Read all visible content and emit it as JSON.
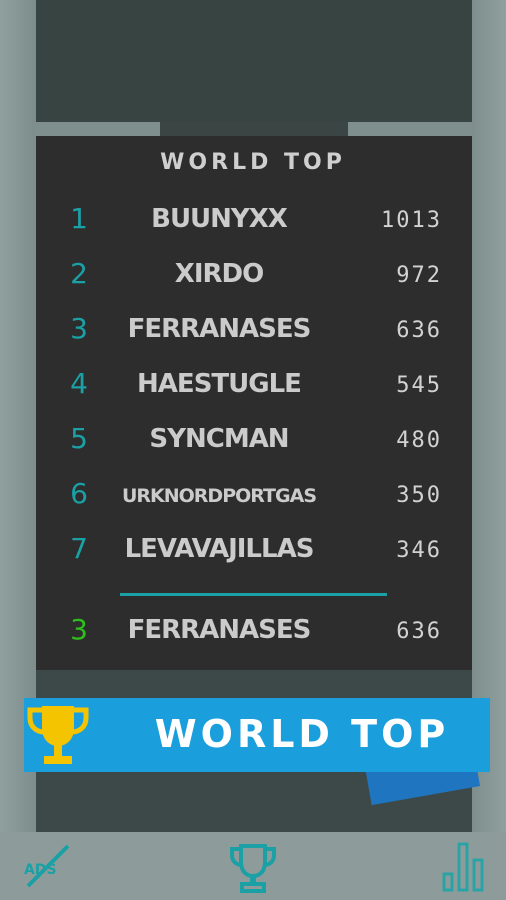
{
  "leaderboard": {
    "title": "WORLD TOP",
    "rows": [
      {
        "rank": "1",
        "name": "BUUNYXX",
        "score": "1013"
      },
      {
        "rank": "2",
        "name": "XIRDO",
        "score": "972"
      },
      {
        "rank": "3",
        "name": "FERRANASES",
        "score": "636"
      },
      {
        "rank": "4",
        "name": "HAESTUGLE",
        "score": "545"
      },
      {
        "rank": "5",
        "name": "SYNCMAN",
        "score": "480"
      },
      {
        "rank": "6",
        "name": "URKNORDPORTGAS",
        "score": "350"
      },
      {
        "rank": "7",
        "name": "LEVAVAJILLAS",
        "score": "346"
      }
    ],
    "player": {
      "rank": "3",
      "name": "FERRANASES",
      "score": "636"
    }
  },
  "banner": {
    "label": "WORLD TOP"
  },
  "colors": {
    "rank_teal": "#1aa0a5",
    "player_rank_green": "#2fbf1b",
    "banner_blue": "#1b9fdc",
    "trophy_gold": "#f5c400",
    "panel_dark": "#2d2d2d"
  },
  "icons": {
    "banner": "trophy-icon",
    "bottom_left": "ads-off-icon",
    "bottom_center": "trophy-icon",
    "bottom_right": "bar-chart-icon"
  }
}
